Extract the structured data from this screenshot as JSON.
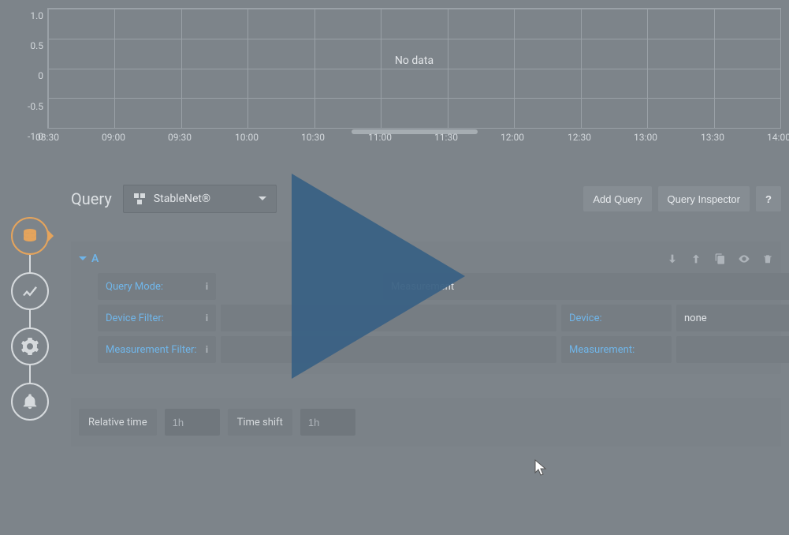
{
  "chart_data": {
    "type": "line",
    "title": "",
    "series": [],
    "message": "No data",
    "x_ticks": [
      "08:30",
      "09:00",
      "09:30",
      "10:00",
      "10:30",
      "11:00",
      "11:30",
      "12:00",
      "12:30",
      "13:00",
      "13:30",
      "14:00"
    ],
    "y_ticks": [
      "1.0",
      "0.5",
      "0",
      "-0.5",
      "-1.0"
    ],
    "ylim": [
      -1.0,
      1.0
    ],
    "xlabel": "",
    "ylabel": ""
  },
  "rail": {
    "steps": [
      "queries",
      "visualization",
      "general",
      "alert"
    ],
    "active": 0
  },
  "header": {
    "title": "Query",
    "datasource": "StableNet®",
    "buttons": {
      "add_query": "Add Query",
      "inspector": "Query Inspector",
      "help": "?"
    }
  },
  "queryA": {
    "letter": "A",
    "icons": [
      "move-down",
      "move-up",
      "duplicate",
      "toggle-visibility",
      "delete"
    ],
    "rows": {
      "query_mode_label": "Query Mode:",
      "query_mode_value": "Measurement",
      "device_filter_label": "Device Filter:",
      "device_filter_value": "",
      "device_label": "Device:",
      "device_value": "none",
      "measurement_filter_label": "Measurement Filter:",
      "measurement_filter_value": "",
      "measurement_label": "Measurement:",
      "measurement_value": ""
    }
  },
  "time": {
    "relative_label": "Relative time",
    "relative_placeholder": "1h",
    "shift_label": "Time shift",
    "shift_placeholder": "1h"
  }
}
